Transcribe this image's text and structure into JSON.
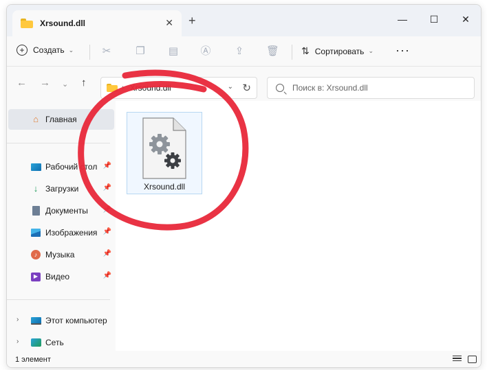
{
  "window": {
    "tab_title": "Xrsound.dll",
    "tab_close_glyph": "✕",
    "new_tab_glyph": "+",
    "minimize_glyph": "—",
    "maximize_glyph": "☐",
    "close_glyph": "✕"
  },
  "toolbar": {
    "create_label": "Создать",
    "sort_label": "Сортировать",
    "more_glyph": "···",
    "icons": [
      "cut-icon",
      "copy-icon",
      "paste-icon",
      "rename-icon",
      "share-icon",
      "delete-icon"
    ]
  },
  "address": {
    "path": "Xrsound.dll",
    "search_placeholder": "Поиск в: Xrsound.dll"
  },
  "sidebar": {
    "home": "Главная",
    "quick_access": [
      {
        "label": "Рабочий стол",
        "icon": "desktop-icon"
      },
      {
        "label": "Загрузки",
        "icon": "downloads-icon"
      },
      {
        "label": "Документы",
        "icon": "documents-icon"
      },
      {
        "label": "Изображения",
        "icon": "pictures-icon"
      },
      {
        "label": "Музыка",
        "icon": "music-icon"
      },
      {
        "label": "Видео",
        "icon": "videos-icon"
      }
    ],
    "this_pc": "Этот компьютер",
    "network": "Сеть"
  },
  "content": {
    "files": [
      {
        "name": "Xrsound.dll",
        "icon": "dll-file-icon",
        "selected": true
      }
    ]
  },
  "status": {
    "item_count": "1 элемент"
  },
  "colors": {
    "accent": "#0067c0",
    "annotation": "#e8283a",
    "folder": "#ffc83d"
  }
}
